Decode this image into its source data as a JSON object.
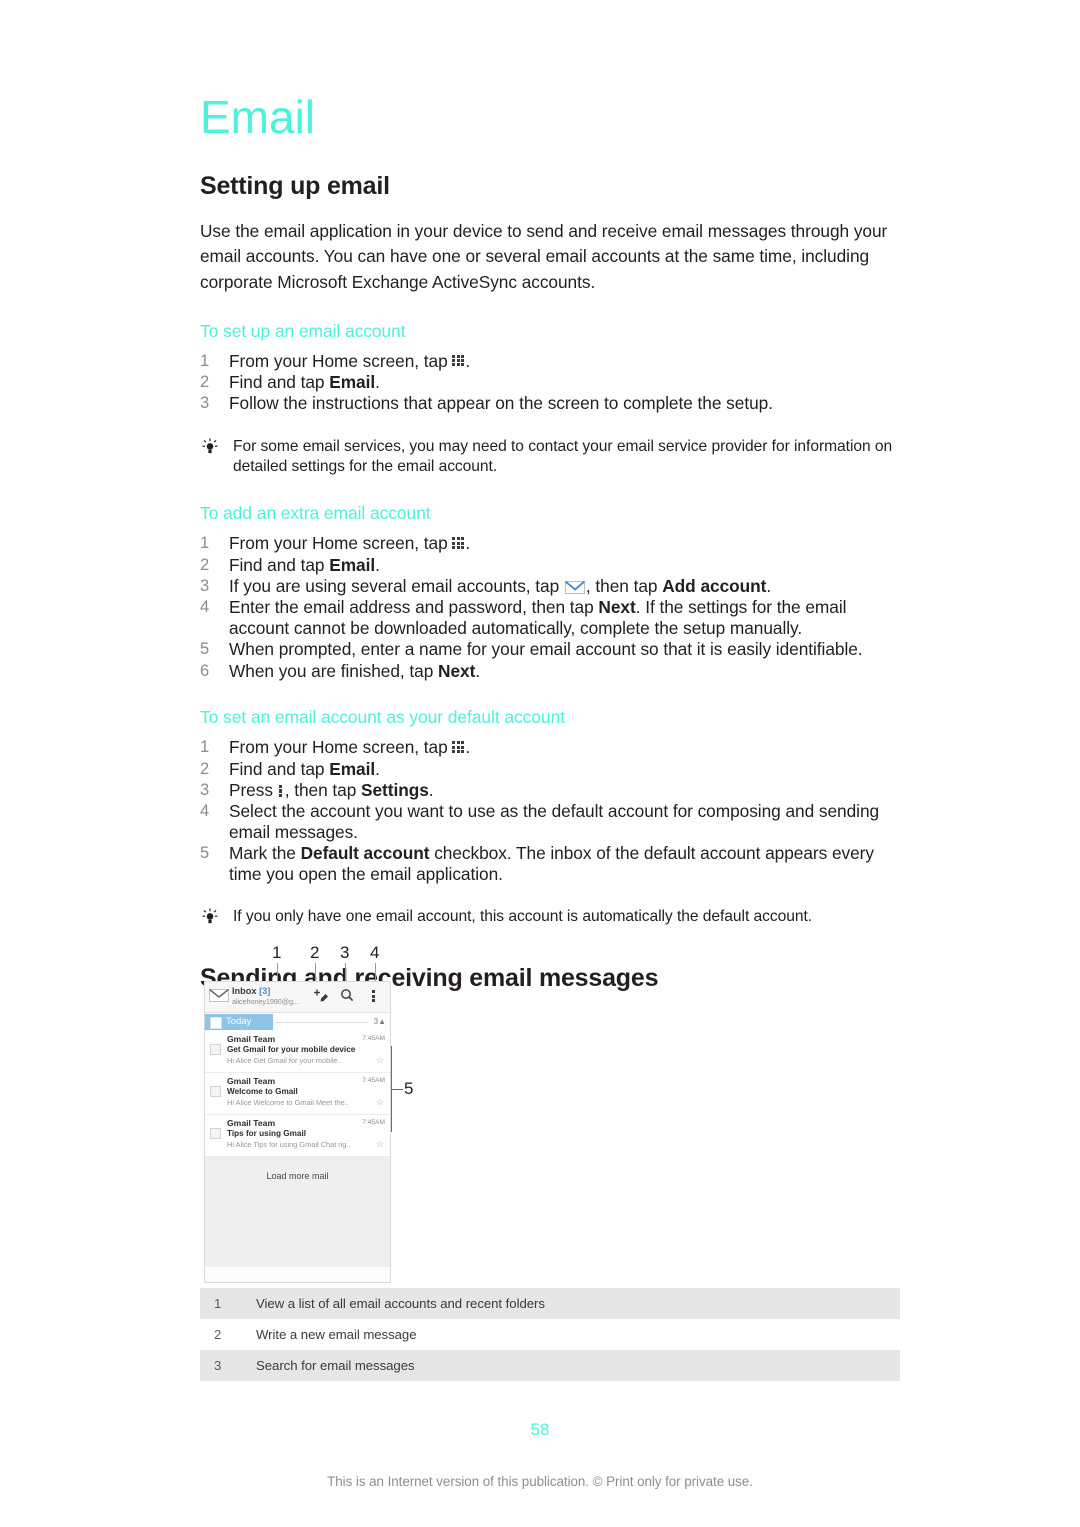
{
  "chapter": {
    "title": "Email"
  },
  "sections": {
    "setting_up": {
      "heading": "Setting up email",
      "intro": "Use the email application in your device to send and receive email messages through your email accounts. You can have one or several email accounts at the same time, including corporate Microsoft Exchange ActiveSync accounts.",
      "proc1": {
        "heading": "To set up an email account",
        "steps": {
          "s1_a": "From your Home screen, tap ",
          "s1_b": ".",
          "s2_a": "Find and tap ",
          "s2_b": "Email",
          "s2_c": ".",
          "s3": "Follow the instructions that appear on the screen to complete the setup."
        }
      },
      "tip1": "For some email services, you may need to contact your email service provider for information on detailed settings for the email account.",
      "proc2": {
        "heading": "To add an extra email account",
        "steps": {
          "s1_a": "From your Home screen, tap ",
          "s1_b": ".",
          "s2_a": "Find and tap ",
          "s2_b": "Email",
          "s2_c": ".",
          "s3_a": "If you are using several email accounts, tap ",
          "s3_b": ", then tap ",
          "s3_c": "Add account",
          "s3_d": ".",
          "s4_a": "Enter the email address and password, then tap ",
          "s4_b": "Next",
          "s4_c": ". If the settings for the email account cannot be downloaded automatically, complete the setup manually.",
          "s5": "When prompted, enter a name for your email account so that it is easily identifiable.",
          "s6_a": "When you are finished, tap ",
          "s6_b": "Next",
          "s6_c": "."
        }
      },
      "proc3": {
        "heading": "To set an email account as your default account",
        "steps": {
          "s1_a": "From your Home screen, tap ",
          "s1_b": ".",
          "s2_a": "Find and tap ",
          "s2_b": "Email",
          "s2_c": ".",
          "s3_a": "Press ",
          "s3_b": ", then tap ",
          "s3_c": "Settings",
          "s3_d": ".",
          "s4": "Select the account you want to use as the default account for composing and sending email messages.",
          "s5_a": "Mark the ",
          "s5_b": "Default account",
          "s5_c": " checkbox. The inbox of the default account appears every time you open the email application."
        }
      },
      "tip2": "If you only have one email account, this account is automatically the default account."
    },
    "sending_receiving": {
      "heading": "Sending and receiving email messages"
    }
  },
  "figure": {
    "callouts": [
      "1",
      "2",
      "3",
      "4",
      "5"
    ],
    "phone": {
      "header": {
        "inbox_label": "Inbox",
        "inbox_count": "[3]",
        "account": "alicehoney1990@g...",
        "compose_icon": "compose-icon",
        "search_icon": "search-icon",
        "overflow_icon": "overflow-menu-icon"
      },
      "today_bar": {
        "label": "Today",
        "count": "3"
      },
      "messages": [
        {
          "sender": "Gmail Team",
          "time": "7:45AM",
          "subject": "Get Gmail for your mobile device",
          "preview": "Hi Alice Get Gmail for your mobile.."
        },
        {
          "sender": "Gmail Team",
          "time": "7:45AM",
          "subject": "Welcome to Gmail",
          "preview": "Hi Alice Welcome to Gmail Meet the.."
        },
        {
          "sender": "Gmail Team",
          "time": "7:45AM",
          "subject": "Tips for using Gmail",
          "preview": "Hi Alice Tips for using Gmail Chat rig.."
        }
      ],
      "load_more": "Load more mail"
    }
  },
  "legend": {
    "rows": [
      {
        "num": "1",
        "desc": "View a list of all email accounts and recent folders"
      },
      {
        "num": "2",
        "desc": "Write a new email message"
      },
      {
        "num": "3",
        "desc": "Search for email messages"
      }
    ]
  },
  "footer": {
    "page_number": "58",
    "note": "This is an Internet version of this publication. © Print only for private use."
  },
  "colors": {
    "accent": "#4df2dc",
    "body_text": "#231f20",
    "muted": "#8e8e8e"
  }
}
